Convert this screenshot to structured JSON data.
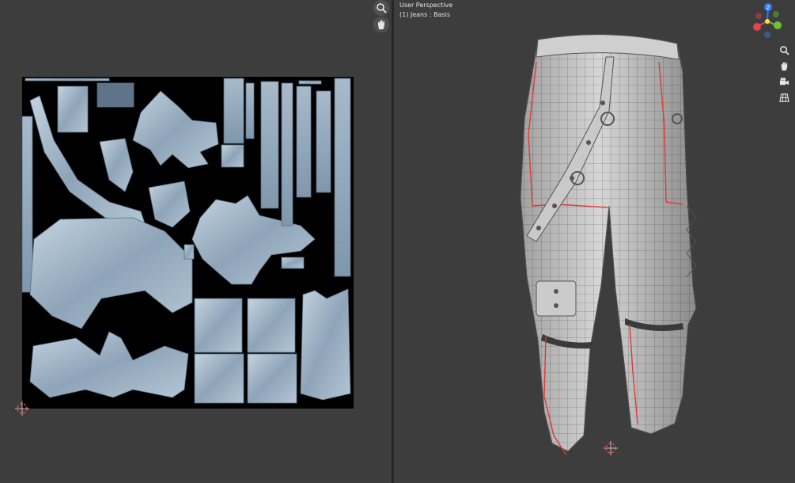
{
  "viewport": {
    "view_name": "User Perspective",
    "object_label": "(1) Jeans : Basis"
  },
  "uv_editor": {
    "tools": [
      "zoom-icon",
      "pan-hand-icon"
    ]
  },
  "viewport_tools": [
    "zoom-icon",
    "pan-hand-icon",
    "camera-icon",
    "grid-ortho-icon"
  ],
  "gizmo": {
    "axes": [
      {
        "label": "Z",
        "color": "#2d7bff"
      },
      {
        "label": "Y",
        "color": "#6fbd3a"
      },
      {
        "label": "X",
        "color": "#e0454f"
      }
    ]
  },
  "colors": {
    "uv_island": "#9fb2c4",
    "uv_background": "#000000",
    "mesh": "#d9d9d9",
    "seam": "#e03a2e",
    "cursor": "#e14b4b"
  }
}
